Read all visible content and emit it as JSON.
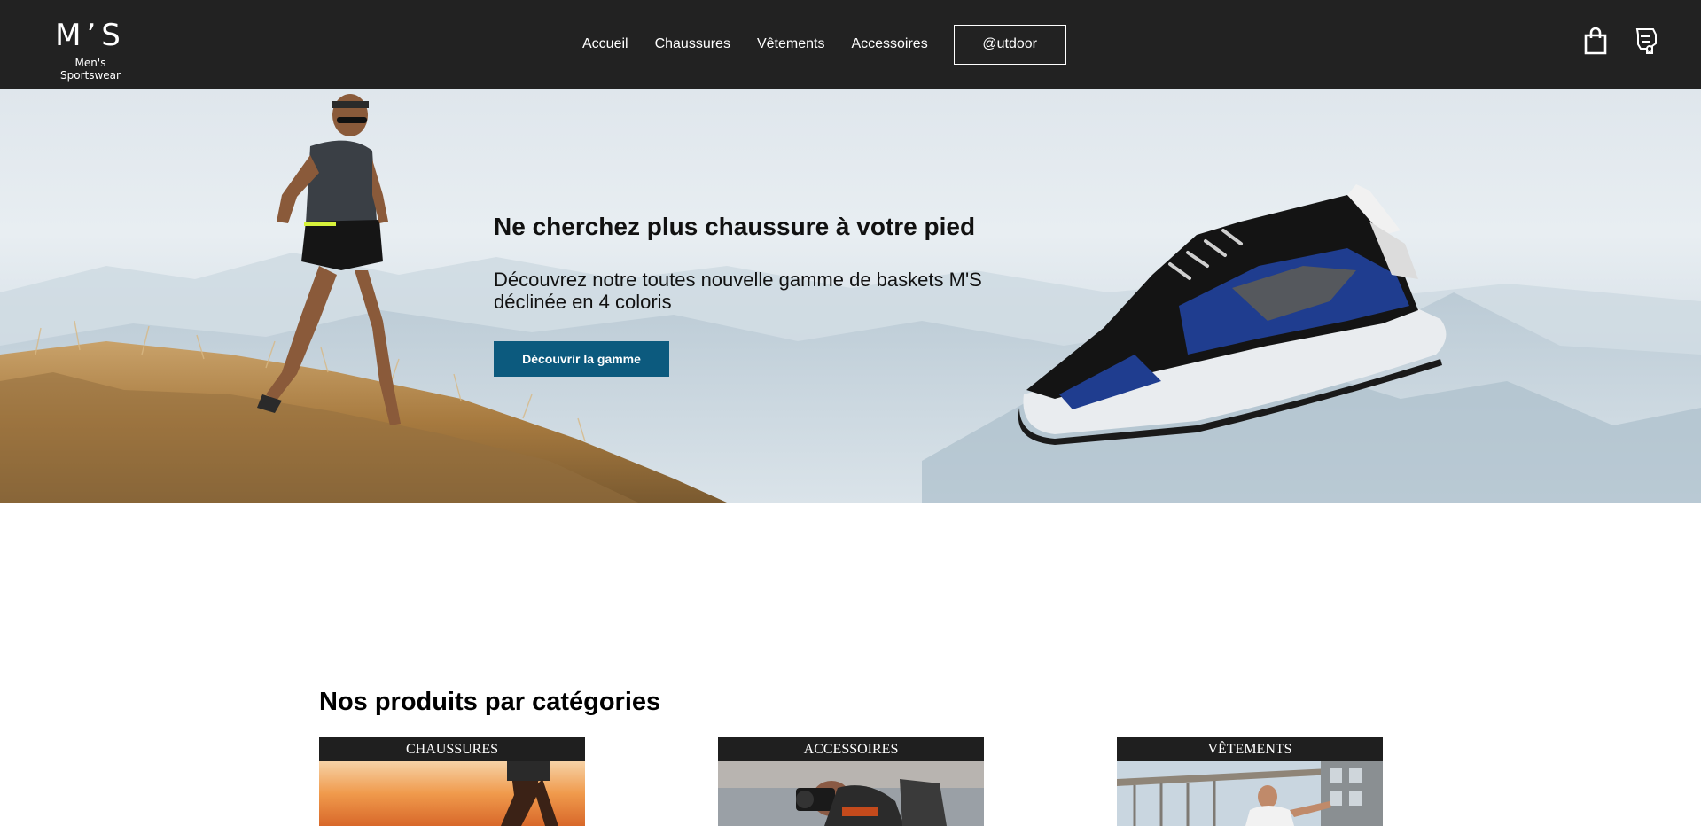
{
  "brand": {
    "logo_mark": "M’S",
    "logo_sub": "Men's Sportswear"
  },
  "nav": {
    "items": [
      "Accueil",
      "Chaussures",
      "Vêtements",
      "Accessoires"
    ],
    "outdoor_label": "@utdoor"
  },
  "header_icons": [
    "shopping-bag-icon",
    "user-account-icon"
  ],
  "hero": {
    "title": "Ne cherchez plus chaussure à votre pied",
    "text": "Découvrez notre toutes nouvelle gamme de baskets M'S déclinée en 4 coloris",
    "button_label": "Découvrir la gamme"
  },
  "categories": {
    "title": "Nos produits par catégories",
    "items": [
      "CHAUSSURES",
      "ACCESSOIRES",
      "VÊTEMENTS"
    ]
  },
  "colors": {
    "header_bg": "#222222",
    "button_bg": "#0c5a7e",
    "category_label_bg": "#1f1f1f"
  }
}
